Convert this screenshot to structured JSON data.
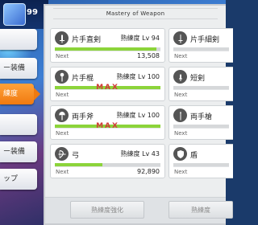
{
  "header": {
    "currency": "99"
  },
  "sidebar": {
    "items": [
      {
        "label": ""
      },
      {
        "label": "ー装備"
      },
      {
        "label": "練度"
      },
      {
        "label": ""
      },
      {
        "label": "ー装備"
      },
      {
        "label": "ップ"
      }
    ]
  },
  "panel": {
    "title": "Mastery of Weapon",
    "weapons": [
      {
        "name": "片手直剣",
        "level_label": "熟練度 Lv 94",
        "next_label": "Next",
        "next_value": "13,508",
        "progress": 0.96,
        "max": false,
        "icon": "sword-icon"
      },
      {
        "name": "片手細剣",
        "level_label": "",
        "next_label": "Next",
        "next_value": "",
        "progress": 0.0,
        "max": false,
        "icon": "rapier-icon"
      },
      {
        "name": "片手棍",
        "level_label": "熟練度 Lv 100",
        "next_label": "Next",
        "next_value": "",
        "progress": 1.0,
        "max": true,
        "max_label": "MAX",
        "icon": "mace-icon"
      },
      {
        "name": "短剣",
        "level_label": "",
        "next_label": "Next",
        "next_value": "",
        "progress": 0.0,
        "max": false,
        "icon": "dagger-icon"
      },
      {
        "name": "両手斧",
        "level_label": "熟練度 Lv 100",
        "next_label": "Next",
        "next_value": "",
        "progress": 1.0,
        "max": true,
        "max_label": "MAX",
        "icon": "axe-icon"
      },
      {
        "name": "両手槍",
        "level_label": "",
        "next_label": "Next",
        "next_value": "",
        "progress": 0.0,
        "max": false,
        "icon": "spear-icon"
      },
      {
        "name": "弓",
        "level_label": "熟練度 Lv 43",
        "next_label": "Next",
        "next_value": "92,890",
        "progress": 0.45,
        "max": false,
        "icon": "bow-icon"
      },
      {
        "name": "盾",
        "level_label": "",
        "next_label": "Next",
        "next_value": "",
        "progress": 0.0,
        "max": false,
        "icon": "shield-icon"
      }
    ],
    "footer": {
      "primary_button": "熟練度強化",
      "secondary_button": "熟練度"
    }
  },
  "colors": {
    "progress": "#8cd43a",
    "max": "#d23a3a",
    "active_tab": "#f07a10"
  }
}
